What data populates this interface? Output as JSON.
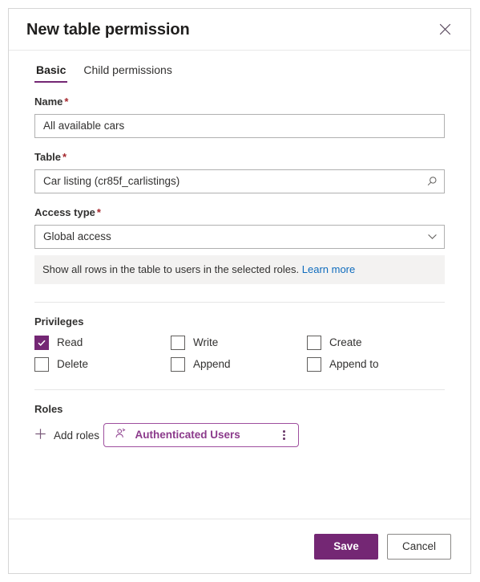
{
  "dialog": {
    "title": "New table permission",
    "close_icon": "close-icon"
  },
  "tabs": [
    {
      "label": "Basic",
      "active": true
    },
    {
      "label": "Child permissions",
      "active": false
    }
  ],
  "form": {
    "name": {
      "label": "Name",
      "required_marker": "*",
      "value": "All available cars",
      "placeholder": "Name"
    },
    "table": {
      "label": "Table",
      "required_marker": "*",
      "value": "Car listing (cr85f_carlistings)",
      "placeholder": "Search for a table",
      "icon": "search-icon"
    },
    "access_type": {
      "label": "Access type",
      "required_marker": "*",
      "value": "Global access",
      "icon": "chevron-down-icon",
      "options": [
        "Global access"
      ]
    },
    "info": {
      "text": "Show all rows in the table to users in the selected roles.",
      "link_label": "Learn more"
    }
  },
  "privileges": {
    "title": "Privileges",
    "items": [
      {
        "label": "Read",
        "checked": true
      },
      {
        "label": "Write",
        "checked": false
      },
      {
        "label": "Create",
        "checked": false
      },
      {
        "label": "Delete",
        "checked": false
      },
      {
        "label": "Append",
        "checked": false
      },
      {
        "label": "Append to",
        "checked": false
      }
    ]
  },
  "roles": {
    "title": "Roles",
    "add_label": "Add roles",
    "add_icon": "plus-icon",
    "chips": [
      {
        "label": "Authenticated Users",
        "icon": "person-icon",
        "menu_icon": "more-vertical-icon"
      }
    ]
  },
  "footer": {
    "save_label": "Save",
    "cancel_label": "Cancel"
  },
  "colors": {
    "accent_purple": "#742774",
    "chip_purple": "#8b3a8b",
    "link_blue": "#0f6cbd",
    "required_red": "#a4262c",
    "info_bg": "#f3f2f1"
  }
}
